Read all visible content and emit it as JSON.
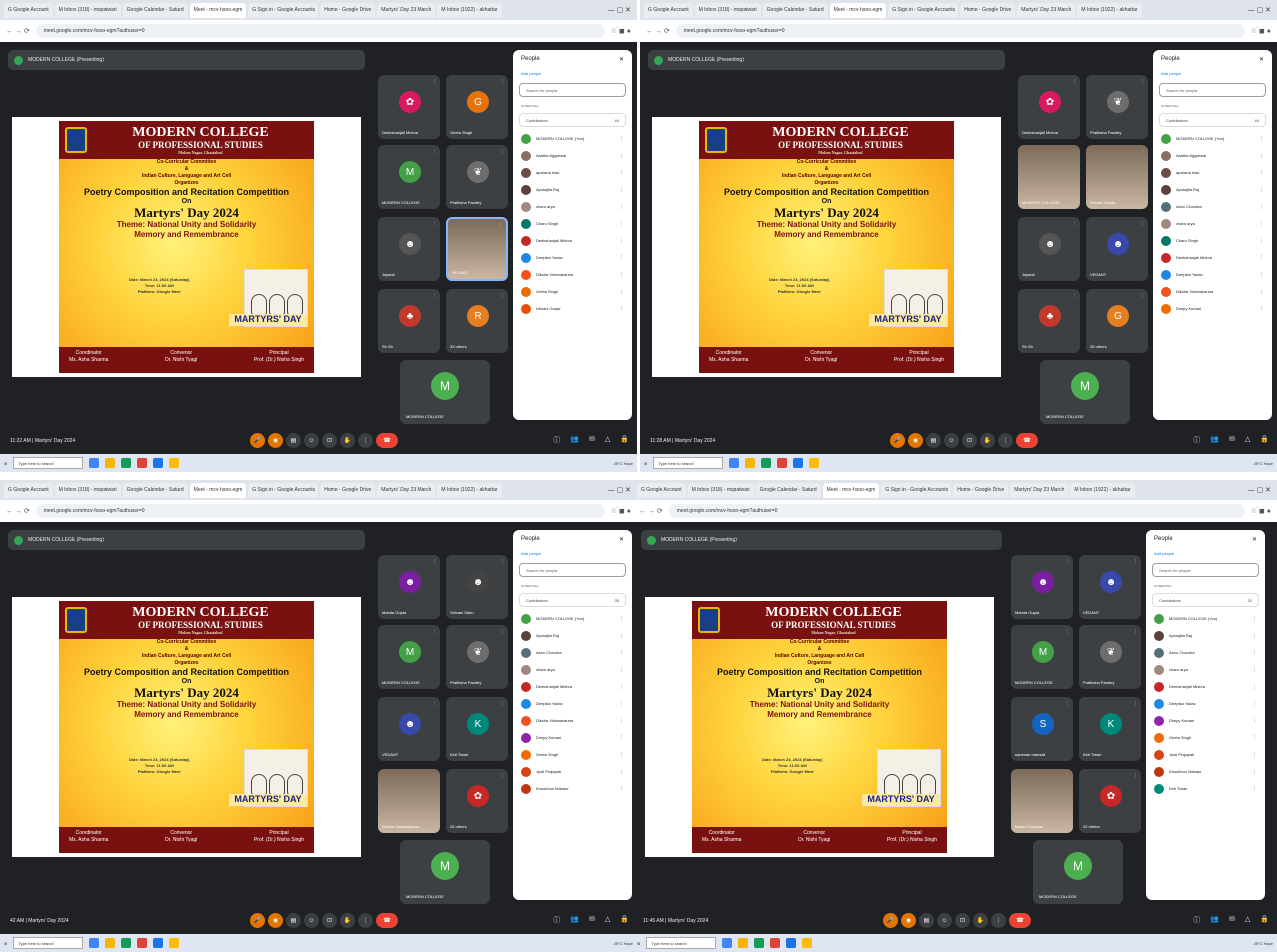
{
  "tabs": [
    "G Google Account",
    "M Inbox (318) - mspatwari",
    "Google Calendar - Saturd",
    "Meet - mcv-hsoo-egm",
    "G Sign in - Google Accounts",
    "Home - Google Drive",
    "Martyrs' Day 23 March",
    "M Inbox (1922) - akhattar"
  ],
  "url": "meet.google.com/mcv-hsoo-egm?authuser=0",
  "presenting_label": "MODERN COLLEGE (Presenting)",
  "slide": {
    "college": "MODERN COLLEGE",
    "college2": "OF PROFESSIONAL STUDIES",
    "location": "Mohan Nagar, Ghaziabad",
    "line1": "Co-Curricular Committee",
    "amp": "&",
    "line2": "Indian Culture, Language and Art Cell",
    "organizes": "Organizes",
    "competition": "Poetry Composition and Recitation Competition",
    "on": "On",
    "event": "Martyrs' Day 2024",
    "theme1": "Theme: National Unity and Solidarity",
    "theme2": "Memory and Remembrance",
    "date": "Date: March 23, 2024 (Saturday)",
    "time": "Time: 11:00 AM",
    "platform": "Platform: Google Meet",
    "stamp": "MARTYRS' DAY",
    "f1a": "Coordinator",
    "f1b": "Ms. Asha Sharma",
    "f2a": "Convenor",
    "f2b": "Dr. Nishi Tyagi",
    "f3a": "Principal",
    "f3b": "Prof. (Dr.) Nisha Singh"
  },
  "people_panel": {
    "title": "People",
    "add": "Add people",
    "search": "Search for people",
    "in_meeting": "IN MEETING",
    "contributors": "Contributors"
  },
  "quads": [
    {
      "time": "11:22 AM | Martyrs' Day 2024",
      "count": "44",
      "tiles": [
        {
          "name": "Deekshanjali Mishra",
          "av": "✿",
          "color": "#d81b60",
          "vid": false
        },
        {
          "name": "Geeta Singh",
          "av": "G",
          "color": "#e8710a",
          "vid": false
        },
        {
          "name": "MODERN COLLEGE",
          "av": "M",
          "color": "#43a047",
          "vid": false
        },
        {
          "name": "Pratiksha Pandey",
          "av": "❦",
          "color": "#6d6d6d",
          "vid": false
        },
        {
          "name": "Jayanti",
          "av": "☻",
          "color": "#555",
          "vid": false
        },
        {
          "name": "VEDANT",
          "av": "",
          "color": "#888",
          "vid": true
        },
        {
          "name": "Sh Sh",
          "av": "♣",
          "color": "#c0392b",
          "vid": false
        },
        {
          "name": "33 others",
          "av": "R",
          "color": "#e67e22",
          "vid": false
        }
      ],
      "list": [
        {
          "name": "MODERN COLLEGE (You)",
          "color": "#43a047"
        },
        {
          "name": "Aastha Aggarwal",
          "color": "#8d6e63"
        },
        {
          "name": "aparana indu",
          "color": "#6d4c41"
        },
        {
          "name": "Apraajita Raj",
          "color": "#5d4037"
        },
        {
          "name": "charu arya",
          "color": "#a1887f"
        },
        {
          "name": "Charu Singh",
          "color": "#00796b"
        },
        {
          "name": "Deekshanjali Mishra",
          "color": "#c62828"
        },
        {
          "name": "Deepika Yadav",
          "color": "#1e88e5"
        },
        {
          "name": "Diksha Vishwakarma",
          "color": "#f4511e"
        },
        {
          "name": "Geeta Singh",
          "color": "#ef6c00"
        },
        {
          "name": "Himani Gurjar",
          "color": "#e65100"
        }
      ]
    },
    {
      "time": "11:28 AM | Martyrs' Day 2024",
      "count": "44",
      "tiles": [
        {
          "name": "Deekshanjali Mishra",
          "av": "✿",
          "color": "#d81b60",
          "vid": false
        },
        {
          "name": "Pratiksha Pandey",
          "av": "❦",
          "color": "#6d6d6d",
          "vid": false
        },
        {
          "name": "MODERN COLLEGE",
          "av": "",
          "color": "#888",
          "vid": true
        },
        {
          "name": "Shivani Gupta",
          "av": "",
          "color": "#888",
          "vid": true
        },
        {
          "name": "Jayanti",
          "av": "☻",
          "color": "#555",
          "vid": false
        },
        {
          "name": "VEDANT",
          "av": "☻",
          "color": "#3949ab",
          "vid": false
        },
        {
          "name": "Sh Sh",
          "av": "♣",
          "color": "#c0392b",
          "vid": false
        },
        {
          "name": "35 others",
          "av": "G",
          "color": "#e67e22",
          "vid": false
        }
      ],
      "list": [
        {
          "name": "MODERN COLLEGE (You)",
          "color": "#43a047"
        },
        {
          "name": "Aastha Aggarwal",
          "color": "#8d6e63"
        },
        {
          "name": "aparana indu",
          "color": "#6d4c41"
        },
        {
          "name": "Apraajita Raj",
          "color": "#5d4037"
        },
        {
          "name": "Ashu Chandra",
          "color": "#546e7a"
        },
        {
          "name": "charu arya",
          "color": "#a1887f"
        },
        {
          "name": "Charu Singh",
          "color": "#00796b"
        },
        {
          "name": "Deekshanjali Mishra",
          "color": "#c62828"
        },
        {
          "name": "Deepika Yadav",
          "color": "#1e88e5"
        },
        {
          "name": "Diksha Vishwakarma",
          "color": "#f4511e"
        },
        {
          "name": "Dimpy Kumari",
          "color": "#ef6c00"
        }
      ]
    },
    {
      "time": "42 AM | Martyrs' Day 2024",
      "count": "35",
      "tiles": [
        {
          "name": "Mamta Gupta",
          "av": "☻",
          "color": "#7b1fa2",
          "vid": false
        },
        {
          "name": "Shivani Sahu",
          "av": "☻",
          "color": "#444",
          "vid": false
        },
        {
          "name": "MODERN COLLEGE",
          "av": "M",
          "color": "#43a047",
          "vid": false
        },
        {
          "name": "Pratiksha Pandey",
          "av": "❦",
          "color": "#6d6d6d",
          "vid": false
        },
        {
          "name": "VEDANT",
          "av": "☻",
          "color": "#3949ab",
          "vid": false
        },
        {
          "name": "Kirti Tiwari",
          "av": "K",
          "color": "#00897b",
          "vid": false
        },
        {
          "name": "Diksha Vishwakarma",
          "av": "",
          "color": "#888",
          "vid": true
        },
        {
          "name": "24 others",
          "av": "✿",
          "color": "#c62828",
          "vid": false
        }
      ],
      "list": [
        {
          "name": "MODERN COLLEGE (You)",
          "color": "#43a047"
        },
        {
          "name": "Apraajita Raj",
          "color": "#5d4037"
        },
        {
          "name": "Ashu Chandra",
          "color": "#546e7a"
        },
        {
          "name": "charu arya",
          "color": "#a1887f"
        },
        {
          "name": "Deekshanjali Mishra",
          "color": "#c62828"
        },
        {
          "name": "Deepika Yadav",
          "color": "#1e88e5"
        },
        {
          "name": "Diksha Vishwakarma",
          "color": "#f4511e"
        },
        {
          "name": "Dimpy Kumari",
          "color": "#8e24aa"
        },
        {
          "name": "Geeta Singh",
          "color": "#ef6c00"
        },
        {
          "name": "Jyoti Prajapati",
          "color": "#d84315"
        },
        {
          "name": "Khushboo Mahaur",
          "color": "#bf360c"
        }
      ]
    },
    {
      "time": "11:45 AM | Martyrs' Day 2024",
      "count": "32",
      "tiles": [
        {
          "name": "Mamta Gupta",
          "av": "☻",
          "color": "#7b1fa2",
          "vid": false
        },
        {
          "name": "VEDANT",
          "av": "☻",
          "color": "#3949ab",
          "vid": false
        },
        {
          "name": "MODERN COLLEGE",
          "av": "M",
          "color": "#43a047",
          "vid": false
        },
        {
          "name": "Pratiksha Pandey",
          "av": "❦",
          "color": "#6d6d6d",
          "vid": false
        },
        {
          "name": "samman mansali",
          "av": "S",
          "color": "#1565c0",
          "vid": false
        },
        {
          "name": "Kirti Tiwari",
          "av": "K",
          "color": "#00897b",
          "vid": false
        },
        {
          "name": "Mansi Chauhan",
          "av": "",
          "color": "#888",
          "vid": true
        },
        {
          "name": "22 others",
          "av": "✿",
          "color": "#c62828",
          "vid": false
        }
      ],
      "list": [
        {
          "name": "MODERN COLLEGE (You)",
          "color": "#43a047"
        },
        {
          "name": "Apraajita Raj",
          "color": "#5d4037"
        },
        {
          "name": "Ashu Chandra",
          "color": "#546e7a"
        },
        {
          "name": "charu arya",
          "color": "#a1887f"
        },
        {
          "name": "Deekshanjali Mishra",
          "color": "#c62828"
        },
        {
          "name": "Deepika Yadav",
          "color": "#1e88e5"
        },
        {
          "name": "Dimpy Kumari",
          "color": "#8e24aa"
        },
        {
          "name": "Geeta Singh",
          "color": "#ef6c00"
        },
        {
          "name": "Jyoti Prajapati",
          "color": "#d84315"
        },
        {
          "name": "Khushboo Mahaur",
          "color": "#bf360c"
        },
        {
          "name": "Kirti Tiwari",
          "color": "#00897b"
        }
      ]
    }
  ],
  "big_tile": {
    "name": "MODERN COLLEGE",
    "av": "M"
  },
  "taskbar": {
    "search": "Type here to search",
    "weather": "29°C Haze"
  }
}
